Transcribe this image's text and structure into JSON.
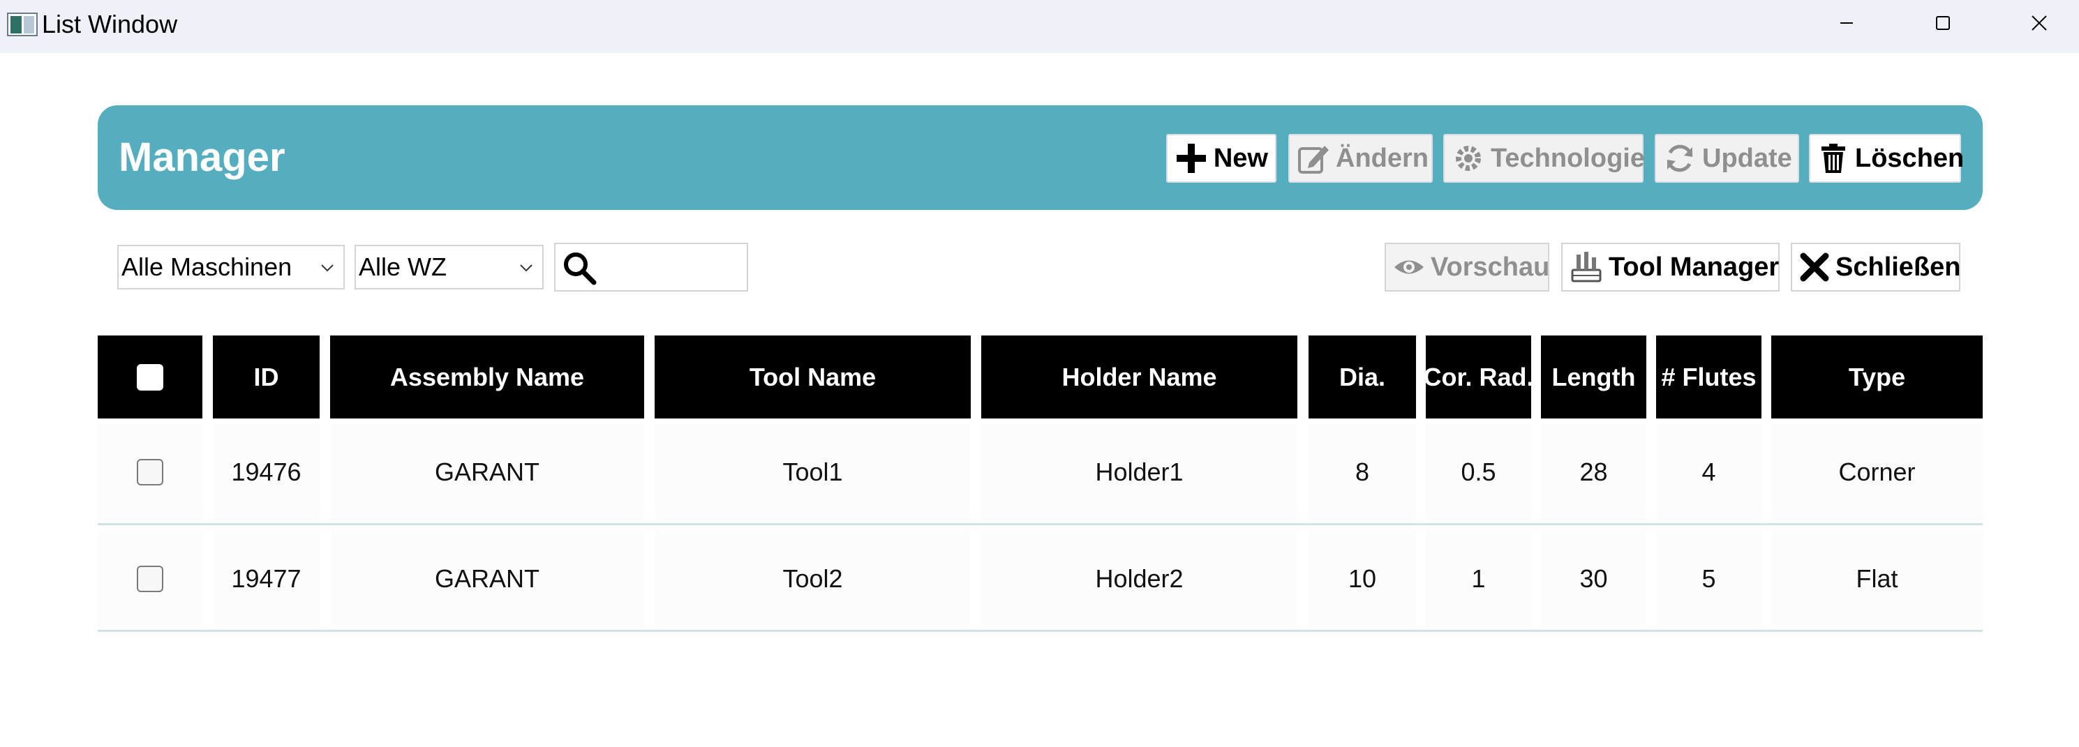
{
  "window": {
    "title": "List Window"
  },
  "header": {
    "title": "Manager",
    "accent_color": "#55adc0",
    "buttons": [
      {
        "label": "New",
        "icon": "plus-icon",
        "enabled": true
      },
      {
        "label": "Ändern",
        "icon": "edit-icon",
        "enabled": false
      },
      {
        "label": "Technologie",
        "icon": "gear-icon",
        "enabled": false
      },
      {
        "label": "Update",
        "icon": "refresh-icon",
        "enabled": false
      },
      {
        "label": "Löschen",
        "icon": "trash-icon",
        "enabled": true
      }
    ]
  },
  "filters": {
    "machine_select": "Alle Maschinen",
    "tool_select": "Alle WZ",
    "search_value": "",
    "search_placeholder": ""
  },
  "actions": {
    "preview": {
      "label": "Vorschau",
      "icon": "eye-icon",
      "enabled": false
    },
    "tool_manager": {
      "label": "Tool Manager",
      "icon": "tools-icon",
      "enabled": true
    },
    "close": {
      "label": "Schließen",
      "icon": "close-x-icon",
      "enabled": true
    }
  },
  "table": {
    "columns": [
      "",
      "ID",
      "Assembly Name",
      "Tool Name",
      "Holder Name",
      "Dia.",
      "Cor. Rad.",
      "Length",
      "# Flutes",
      "Type"
    ],
    "rows": [
      {
        "checked": false,
        "cells": [
          "19476",
          "GARANT",
          "Tool1",
          "Holder1",
          "8",
          "0.5",
          "28",
          "4",
          "Corner"
        ]
      },
      {
        "checked": false,
        "cells": [
          "19477",
          "GARANT",
          "Tool2",
          "Holder2",
          "10",
          "1",
          "30",
          "5",
          "Flat"
        ]
      }
    ]
  }
}
